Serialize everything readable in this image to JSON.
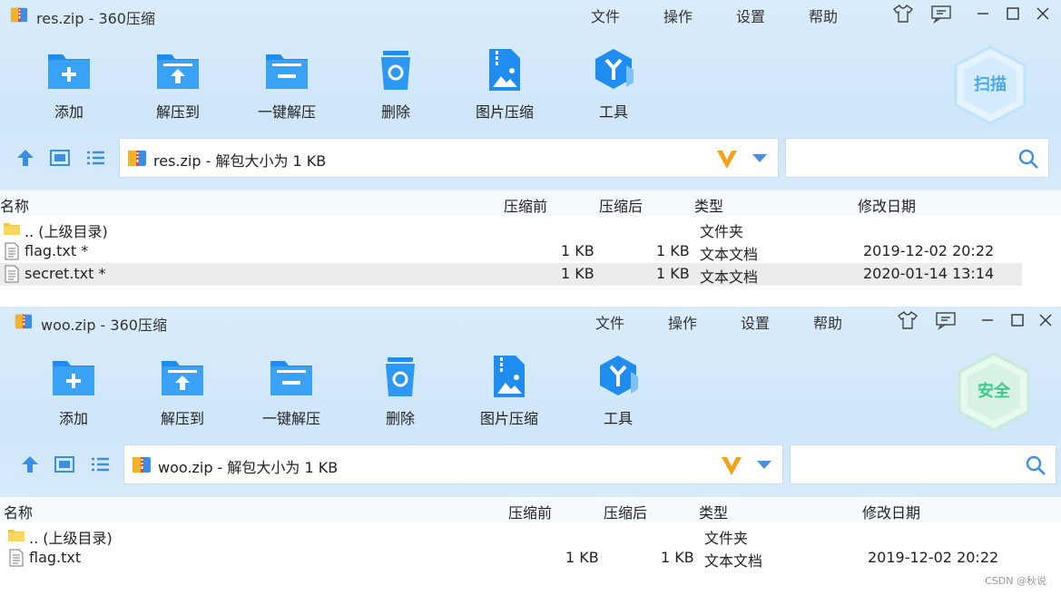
{
  "windows": [
    {
      "title": "res.zip - 360压缩",
      "menu": [
        "文件",
        "操作",
        "设置",
        "帮助"
      ],
      "toolbar": [
        "添加",
        "解压到",
        "一键解压",
        "删除",
        "图片压缩",
        "工具"
      ],
      "badge": "扫描",
      "badge_color": "#49a8f3",
      "address": "res.zip - 解包大小为 1 KB",
      "search_placeholder": "",
      "headers": {
        "name": "名称",
        "before": "压缩前",
        "after": "压缩后",
        "type": "类型",
        "date": "修改日期"
      },
      "rows": [
        {
          "icon": "folder-icon",
          "name": ".. (上级目录)",
          "before": "",
          "after": "",
          "type": "文件夹",
          "date": ""
        },
        {
          "icon": "text-file-icon",
          "name": "flag.txt *",
          "before": "1 KB",
          "after": "1 KB",
          "type": "文本文档",
          "date": "2019-12-02 20:22"
        },
        {
          "icon": "text-file-icon",
          "name": "secret.txt *",
          "before": "1 KB",
          "after": "1 KB",
          "type": "文本文档",
          "date": "2020-01-14 13:14",
          "selected": true
        }
      ]
    },
    {
      "title": "woo.zip - 360压缩",
      "menu": [
        "文件",
        "操作",
        "设置",
        "帮助"
      ],
      "toolbar": [
        "添加",
        "解压到",
        "一键解压",
        "删除",
        "图片压缩",
        "工具"
      ],
      "badge": "安全",
      "badge_color": "#3cc98a",
      "address": "woo.zip - 解包大小为 1 KB",
      "search_placeholder": "",
      "headers": {
        "name": "名称",
        "before": "压缩前",
        "after": "压缩后",
        "type": "类型",
        "date": "修改日期"
      },
      "rows": [
        {
          "icon": "folder-icon",
          "name": ".. (上级目录)",
          "before": "",
          "after": "",
          "type": "文件夹",
          "date": ""
        },
        {
          "icon": "text-file-icon",
          "name": "flag.txt",
          "before": "1 KB",
          "after": "1 KB",
          "type": "文本文档",
          "date": "2019-12-02 20:22"
        }
      ]
    }
  ],
  "watermark": "CSDN @秋说",
  "colors": {
    "accent": "#1a8cf0",
    "chrome": "#d4e8fa",
    "selected_row": "#ececec"
  }
}
